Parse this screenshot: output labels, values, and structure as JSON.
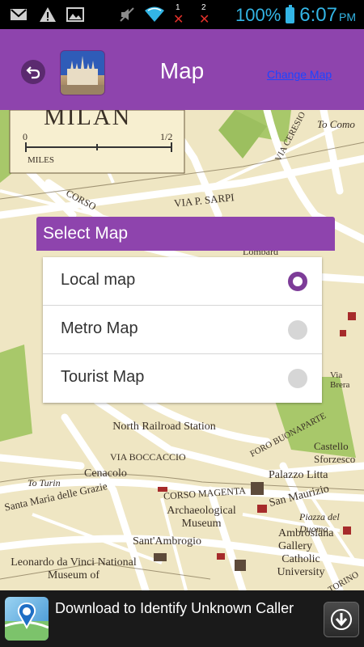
{
  "status_bar": {
    "battery_percent": "100%",
    "time": "6:07",
    "ampm": "PM",
    "sim1": "1",
    "sim2": "2",
    "icons": [
      "mail-icon",
      "warning-icon",
      "image-icon",
      "mute-icon",
      "wifi-icon",
      "signal-1-icon",
      "signal-2-icon",
      "battery-icon"
    ]
  },
  "app_bar": {
    "title": "Map",
    "change_map_link": "Change Map",
    "back_icon": "back-arrow-icon",
    "thumbnail_icon": "milan-cathedral-thumbnail"
  },
  "map": {
    "city_label": "MILAN",
    "scale_zero": "0",
    "scale_half": "1/2",
    "scale_unit": "MILES",
    "labels": [
      "To Como",
      "VIA P. SARPI",
      "VIA CERESIO",
      "CORSO",
      "Lombard",
      "North Railroad Station",
      "VIA BOCCACCIO",
      "Cenacolo",
      "FORO BUONAPARTE",
      "Palazzo Litta",
      "Castello Sforzesco",
      "CORSO MAGENTA",
      "San Maurizio",
      "To Turin",
      "Santa Maria delle Grazie",
      "Archaeological Museum",
      "Piazza del Duomo",
      "Ambrosiana Gallery",
      "Sant'Ambrogio",
      "Leonardo da Vinci National Museum of",
      "Catholic University",
      "TORINO",
      "Via Brera"
    ]
  },
  "dialog": {
    "title": "Select Map",
    "options": [
      {
        "label": "Local map",
        "selected": true
      },
      {
        "label": "Metro Map",
        "selected": false
      },
      {
        "label": "Tourist Map",
        "selected": false
      }
    ]
  },
  "ad": {
    "text": "Download to Identify Unknown Caller",
    "icon": "caller-id-app-icon",
    "download_icon": "download-arrow-icon"
  },
  "colors": {
    "accent": "#8e44ad",
    "status_blue": "#33b5e5",
    "link": "#1d44ff",
    "radio_selected": "#7d3c98"
  }
}
